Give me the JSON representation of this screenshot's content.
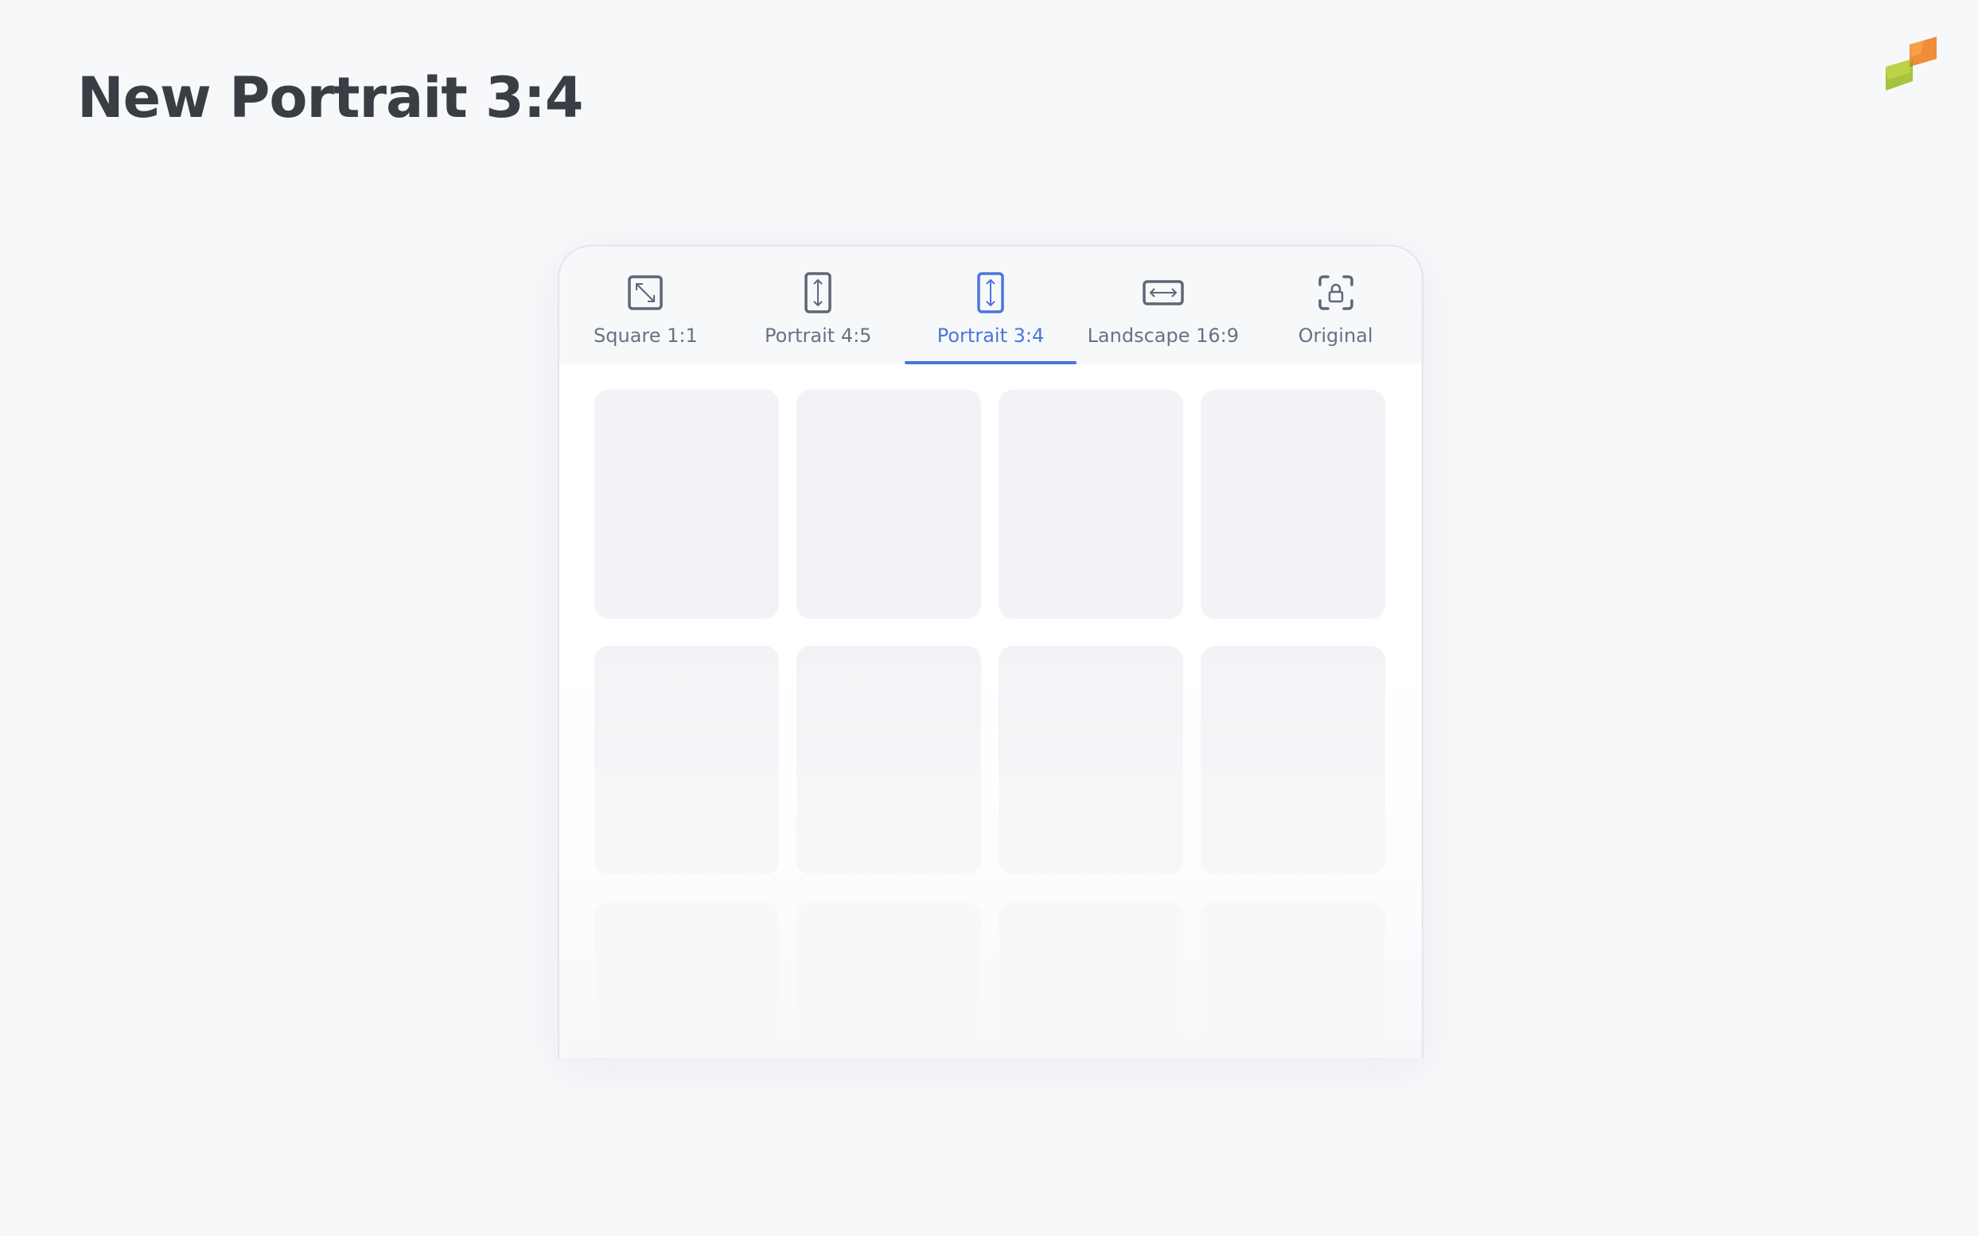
{
  "page": {
    "title": "New Portrait 3:4"
  },
  "tabs": [
    {
      "label": "Square 1:1",
      "icon": "square-resize-icon",
      "active": false
    },
    {
      "label": "Portrait 4:5",
      "icon": "portrait-resize-icon",
      "active": false
    },
    {
      "label": "Portrait 3:4",
      "icon": "portrait-resize-icon",
      "active": true
    },
    {
      "label": "Landscape 16:9",
      "icon": "landscape-resize-icon",
      "active": false
    },
    {
      "label": "Original",
      "icon": "lock-frame-icon",
      "active": false
    }
  ],
  "colors": {
    "accent": "#4a76dc",
    "icon": "#5f6678",
    "title": "#3a3d44",
    "background": "#f7f8fa",
    "placeholder": "#f2f3f6",
    "logo_orange": "#f28c38",
    "logo_green": "#a6c43c"
  },
  "logo": {
    "icon": "brand-logo-icon"
  }
}
